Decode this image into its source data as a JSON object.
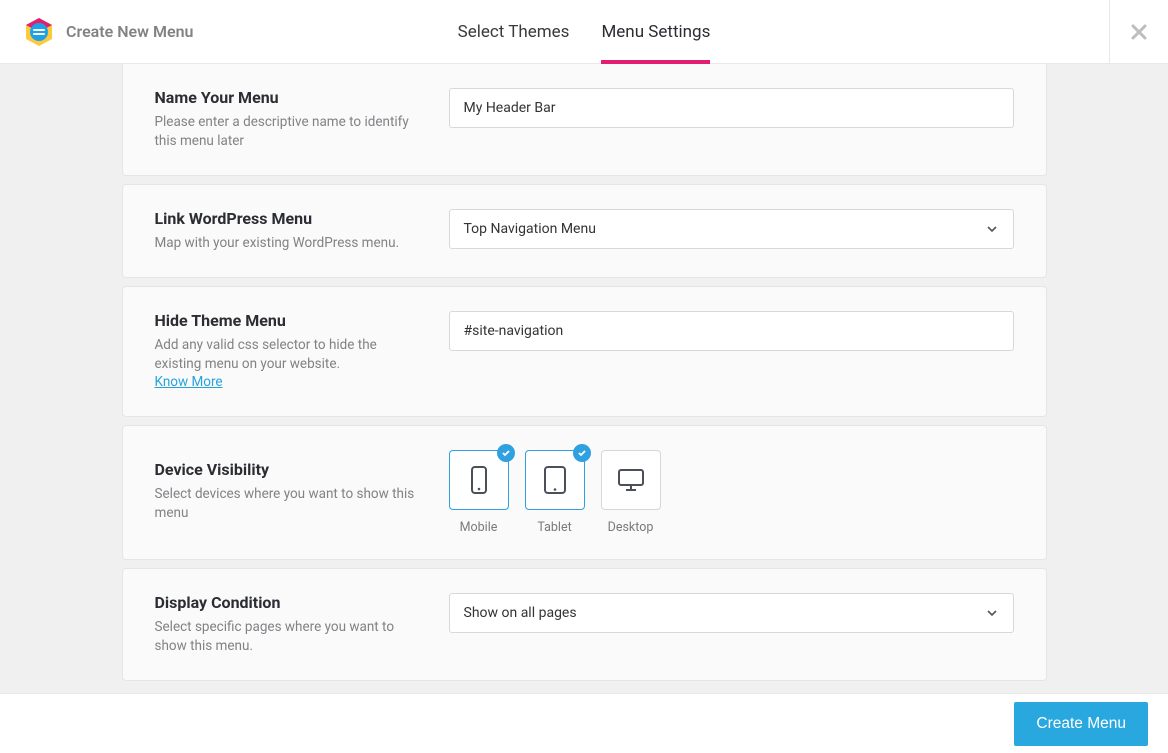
{
  "header": {
    "title": "Create New Menu",
    "tabs": [
      {
        "label": "Select Themes",
        "active": false
      },
      {
        "label": "Menu Settings",
        "active": true
      }
    ]
  },
  "sections": {
    "name": {
      "title": "Name Your Menu",
      "desc": "Please enter a descriptive name to identify this menu later",
      "value": "My Header Bar"
    },
    "link_wp": {
      "title": "Link WordPress Menu",
      "desc": "Map with your existing WordPress menu.",
      "value": "Top Navigation Menu"
    },
    "hide_theme": {
      "title": "Hide Theme Menu",
      "desc": "Add any valid css selector to hide the existing menu on your website.",
      "link_label": "Know More",
      "value": "#site-navigation"
    },
    "device": {
      "title": "Device Visibility",
      "desc": "Select devices where you want to show this menu",
      "options": [
        {
          "label": "Mobile",
          "selected": true
        },
        {
          "label": "Tablet",
          "selected": true
        },
        {
          "label": "Desktop",
          "selected": false
        }
      ]
    },
    "display": {
      "title": "Display Condition",
      "desc": "Select specific pages where you want to show this menu.",
      "value": "Show on all pages"
    }
  },
  "footer": {
    "button": "Create Menu"
  }
}
